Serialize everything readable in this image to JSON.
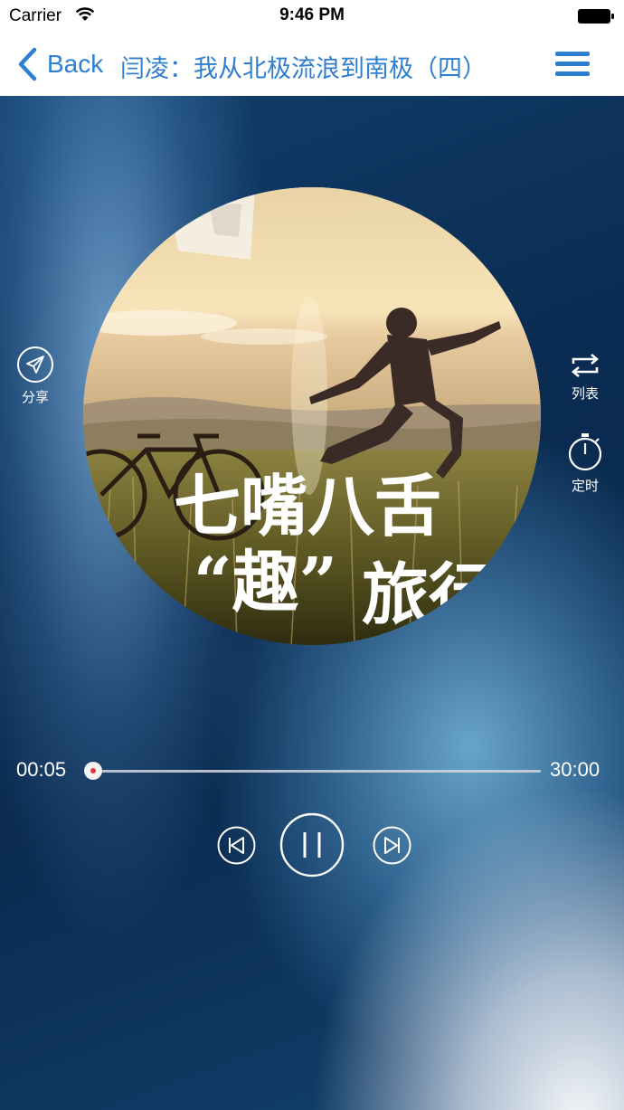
{
  "status_bar": {
    "carrier": "Carrier",
    "time": "9:46 PM"
  },
  "nav": {
    "back_label": "Back",
    "title": "闫凌：我从北极流浪到南极（四）",
    "accent_color": "#2f7fd1"
  },
  "album": {
    "title_line1": "七嘴八舌",
    "title_line2_quote": "“趣”",
    "title_line2_rest": "旅行"
  },
  "side_actions": {
    "share_label": "分享",
    "playlist_label": "列表",
    "timer_label": "定时"
  },
  "player": {
    "current_time": "00:05",
    "total_time": "30:00",
    "progress_fraction": 0.003,
    "state": "playing"
  },
  "icons": [
    "wifi-icon",
    "battery-icon",
    "back-chevron-icon",
    "menu-icon",
    "share-icon",
    "repeat-icon",
    "timer-icon",
    "previous-icon",
    "pause-icon",
    "next-icon"
  ]
}
